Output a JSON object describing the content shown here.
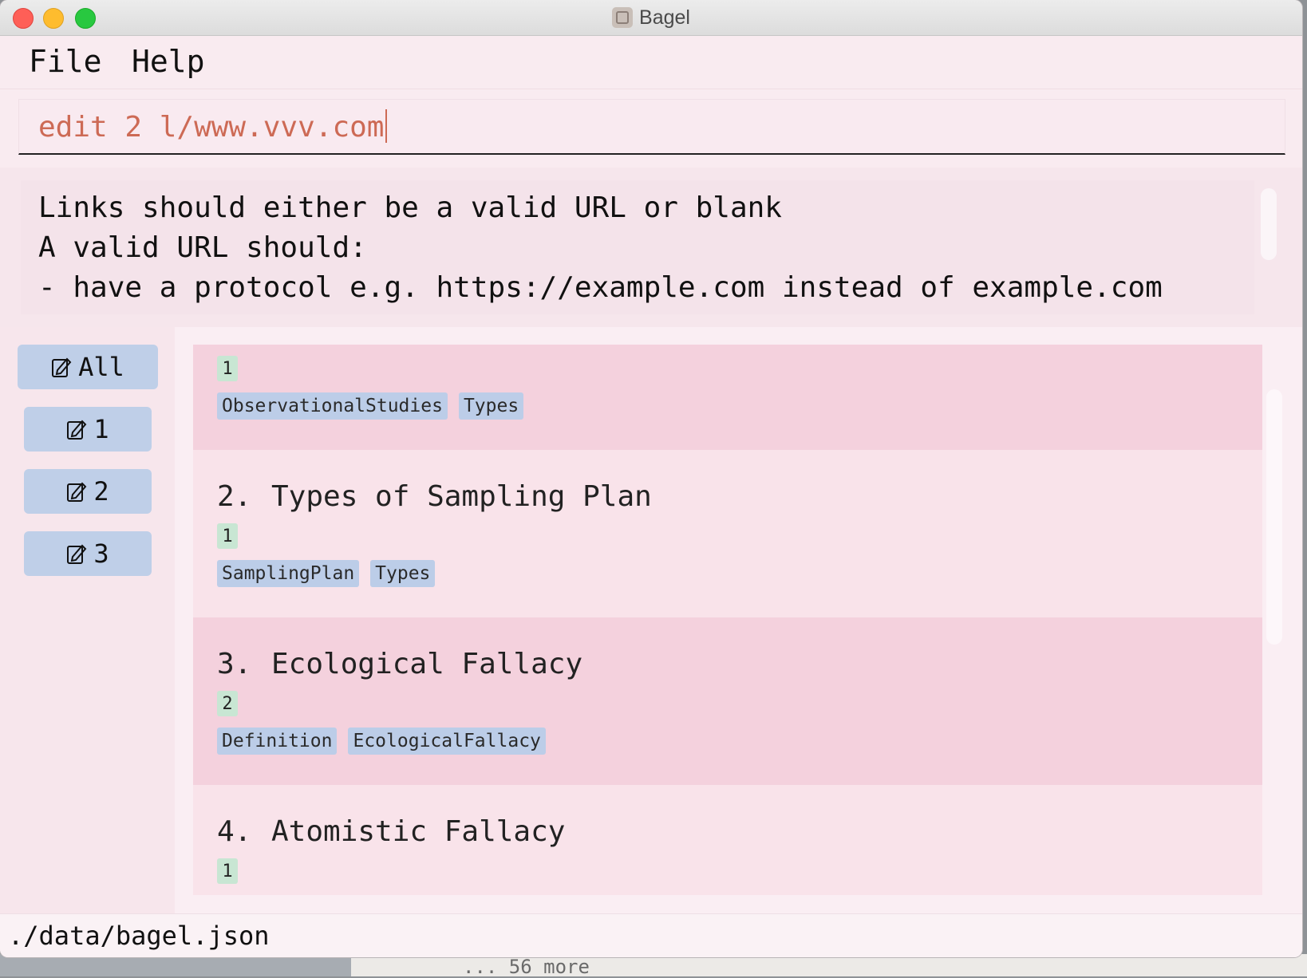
{
  "window": {
    "title": "Bagel"
  },
  "menu": {
    "file": "File",
    "help": "Help"
  },
  "command": {
    "value": "edit 2 l/www.vvv.com"
  },
  "result": {
    "lines": [
      "Links should either be a valid URL or blank",
      "A valid URL should:",
      "- have a protocol e.g. https://example.com instead of example.com"
    ]
  },
  "sidebar": {
    "buttons": [
      {
        "label": "All",
        "icon": "note-edit-icon"
      },
      {
        "label": "1",
        "icon": "note-edit-icon"
      },
      {
        "label": "2",
        "icon": "note-edit-icon"
      },
      {
        "label": "3",
        "icon": "note-edit-icon"
      }
    ]
  },
  "cards": [
    {
      "index": "",
      "title": "",
      "priority": "1",
      "tags": [
        "ObservationalStudies",
        "Types"
      ]
    },
    {
      "index": "2.",
      "title": "Types of Sampling Plan",
      "priority": "1",
      "tags": [
        "SamplingPlan",
        "Types"
      ]
    },
    {
      "index": "3.",
      "title": "Ecological Fallacy",
      "priority": "2",
      "tags": [
        "Definition",
        "EcologicalFallacy"
      ]
    },
    {
      "index": "4.",
      "title": "Atomistic Fallacy",
      "priority": "1",
      "tags": []
    }
  ],
  "status": {
    "path": "./data/bagel.json"
  },
  "desktop": {
    "more": "... 56 more"
  },
  "colors": {
    "accent_command": "#cd6a55",
    "card_alt": "#f4d1dd",
    "card_plain": "#f9e3ea",
    "tag_bg": "#bccde8",
    "priority_bg": "#c8e6d3",
    "sidebar_button": "#bfcfe8"
  }
}
